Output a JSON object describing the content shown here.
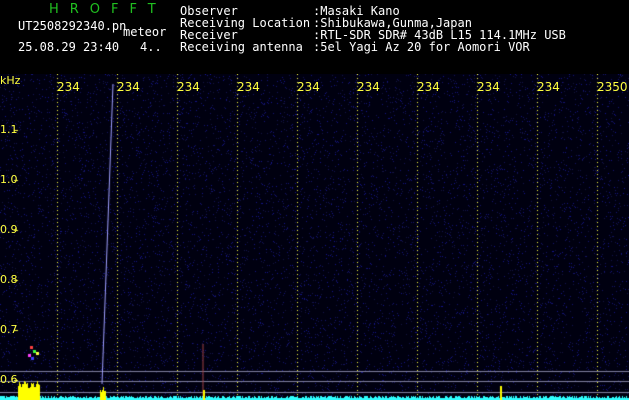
{
  "header": {
    "logo": "HROFFT",
    "filename": "UT2508292340.pn",
    "tag": "meteor",
    "timestamp": "25.08.29 23:40",
    "count": "4.."
  },
  "info": {
    "labels": [
      "Observer",
      "Receiving Location",
      "Receiver",
      "Receiving antenna"
    ],
    "values": [
      ":Masaki Kano",
      ":Shibukawa,Gunma,Japan",
      ":RTL-SDR SDR# 43dB L15 114.1MHz USB",
      ":5el Yagi Az 20 for Aomori VOR"
    ]
  },
  "axis": {
    "y_unit": "kHz",
    "y_ticks": [
      "1.1",
      "1.0",
      "0.9",
      "0.8",
      "0.7",
      "0.6"
    ],
    "x_ticks": [
      "234",
      "234",
      "234",
      "234",
      "234",
      "234",
      "234",
      "234",
      "234",
      "2350"
    ]
  },
  "colors": {
    "background": "#000000",
    "noise": "#0a0a50",
    "tick_text": "#ffff40",
    "trace": "#30ffff",
    "echo": "#ffff00",
    "logo": "#20c020"
  }
}
